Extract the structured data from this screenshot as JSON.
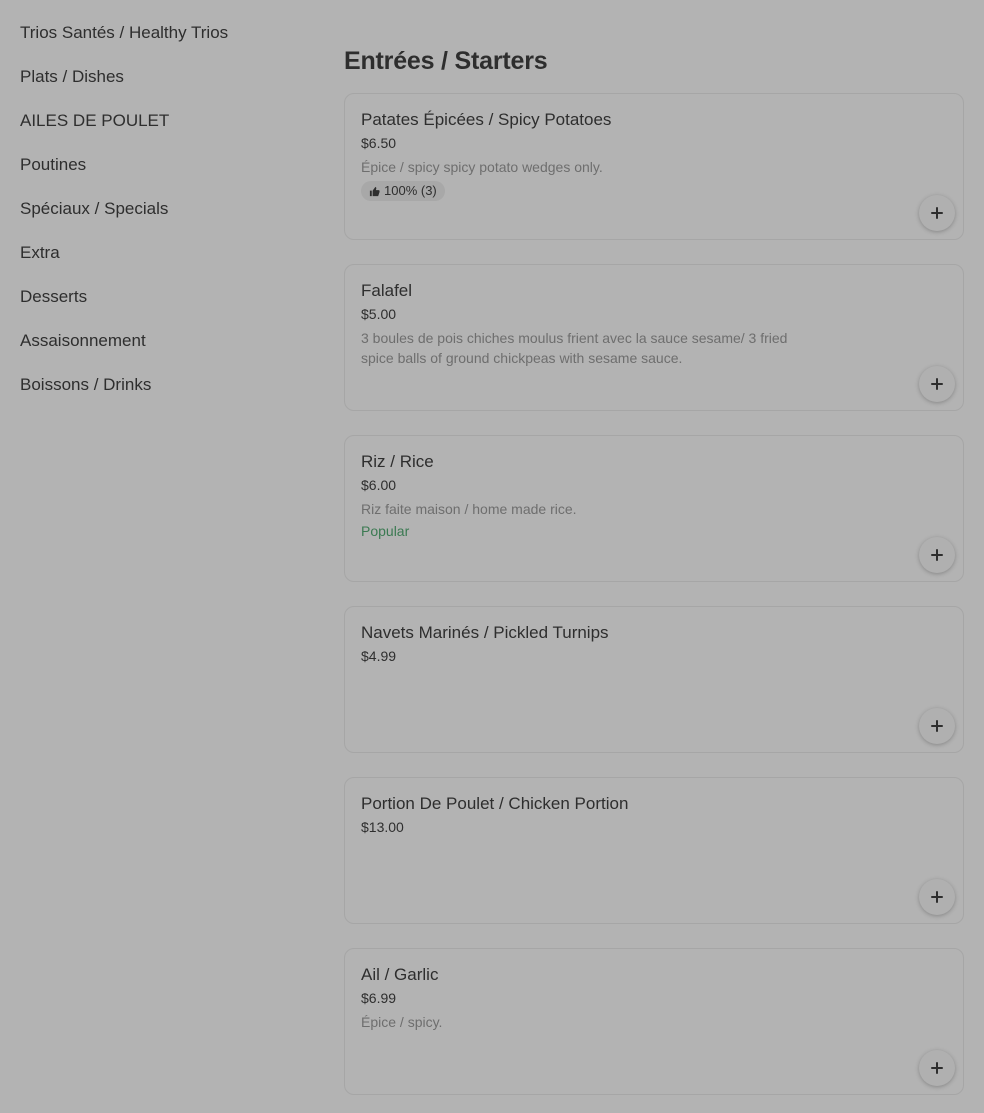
{
  "sidebar": {
    "items": [
      {
        "label": "Trios Santés / Healthy Trios"
      },
      {
        "label": "Plats / Dishes"
      },
      {
        "label": "AILES DE POULET"
      },
      {
        "label": "Poutines"
      },
      {
        "label": "Spéciaux / Specials"
      },
      {
        "label": "Extra"
      },
      {
        "label": "Desserts"
      },
      {
        "label": "Assaisonnement"
      },
      {
        "label": "Boissons / Drinks"
      }
    ]
  },
  "main": {
    "section_title": "Entrées / Starters",
    "items": [
      {
        "name": "Patates Épicées / Spicy Potatoes",
        "price": "$6.50",
        "description": "Épice / spicy spicy potato wedges only.",
        "rating": "100% (3)",
        "rating_icon": "thumbs-up-icon"
      },
      {
        "name": "Falafel",
        "price": "$5.00",
        "description": "3 boules de pois chiches moulus frient avec la sauce sesame/ 3 fried spice balls of ground chickpeas with sesame sauce."
      },
      {
        "name": "Riz / Rice",
        "price": "$6.00",
        "description": "Riz faite maison / home made rice.",
        "tag": "Popular"
      },
      {
        "name": "Navets Marinés / Pickled Turnips",
        "price": "$4.99"
      },
      {
        "name": "Portion De Poulet / Chicken Portion",
        "price": "$13.00"
      },
      {
        "name": "Ail / Garlic",
        "price": "$6.99",
        "description": "Épice / spicy."
      }
    ],
    "add_icon": "plus-icon"
  },
  "colors": {
    "background": "#b3b3b3",
    "text": "#2e2e2e",
    "muted_text": "#6e6e6e",
    "popular": "#3b7a52",
    "card_border": "#a6a6a6"
  }
}
